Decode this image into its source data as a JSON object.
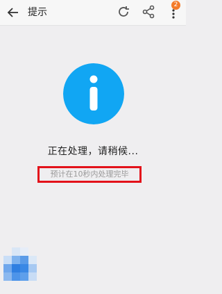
{
  "header": {
    "title": "提示",
    "badge_count": "2"
  },
  "icons": {
    "back": "arrow-left-icon",
    "refresh": "refresh-icon",
    "share": "share-icon",
    "more": "more-vertical-icon",
    "info": "info-icon"
  },
  "main": {
    "status_text": "正在处理，请稍候...",
    "hint_text": "预计在10秒内处理完毕"
  },
  "colors": {
    "accent": "#11a6f3",
    "highlight_border": "#e3111a",
    "badge": "#f47b2a"
  }
}
